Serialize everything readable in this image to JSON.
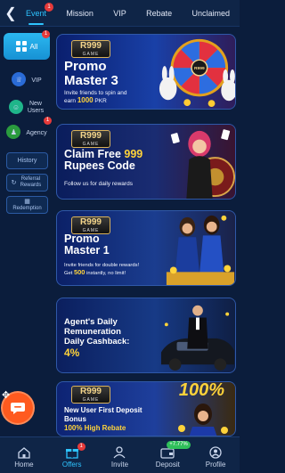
{
  "tabs": [
    {
      "label": "Event",
      "badge": "1",
      "active": true
    },
    {
      "label": "Mission",
      "badge": "",
      "active": false
    },
    {
      "label": "VIP",
      "badge": "",
      "active": false
    },
    {
      "label": "Rebate",
      "badge": "",
      "active": false
    },
    {
      "label": "Unclaimed",
      "badge": "",
      "active": false
    }
  ],
  "sidebar": {
    "items": [
      {
        "label": "All",
        "badge": "1",
        "icon": "grid-icon"
      },
      {
        "label": "VIP",
        "badge": "",
        "icon": "vip-crown-icon"
      },
      {
        "label": "New Users",
        "badge": "",
        "icon": "new-users-icon"
      },
      {
        "label": "Agency",
        "badge": "1",
        "icon": "agency-icon"
      }
    ],
    "buttons": [
      {
        "label": "History",
        "icon": ""
      },
      {
        "label": "Referral Rewards",
        "icon": "referral-icon"
      },
      {
        "label": "Redemption",
        "icon": "redemption-icon"
      }
    ]
  },
  "banners": [
    {
      "logo_main": "R999",
      "logo_sub": "GAME",
      "title_line1": "Promo",
      "title_line2": "Master 3",
      "sub_line1": "Invite friends to spin and",
      "sub_line2_prefix": "earn ",
      "sub_line2_amount": "1000",
      "sub_line2_suffix": " PKR",
      "wheel_center": "R999"
    },
    {
      "logo_main": "R999",
      "logo_sub": "GAME",
      "title_line1_prefix": "Claim Free ",
      "title_line1_amount": "999",
      "title_line2": "Rupees Code",
      "sub_line1": "Follow us for daily rewards"
    },
    {
      "logo_main": "R999",
      "logo_sub": "GAME",
      "title_line1": "Promo",
      "title_line2": "Master 1",
      "sub_line1": "Invite friends for double rewards!",
      "sub_line2_prefix": "Get ",
      "sub_line2_amount": "500",
      "sub_line2_suffix": " instantly, no limit!"
    },
    {
      "title_line1": "Agent's Daily",
      "title_line2": "Remuneration",
      "title_line3": "Daily Cashback:",
      "title_line4": "4%"
    },
    {
      "logo_main": "R999",
      "logo_sub": "GAME",
      "corner_big": "100%",
      "title_line1": "New User First Deposit",
      "title_line2": "Bonus",
      "title_line3": "100% High Rebate"
    }
  ],
  "bottom_nav": [
    {
      "label": "Home",
      "icon": "home-icon",
      "badge": "",
      "pill": "",
      "active": false
    },
    {
      "label": "Offers",
      "icon": "gift-icon",
      "badge": "1",
      "pill": "",
      "active": true
    },
    {
      "label": "Invite",
      "icon": "invite-icon",
      "badge": "",
      "pill": "",
      "active": false
    },
    {
      "label": "Deposit",
      "icon": "wallet-icon",
      "badge": "",
      "pill": "+7.77%",
      "active": false
    },
    {
      "label": "Profile",
      "icon": "profile-icon",
      "badge": "",
      "pill": "",
      "active": false
    }
  ],
  "colors": {
    "background": "#0b1d3c",
    "accent": "#2ec4ff",
    "badge": "#e53a3a",
    "gold": "#ffd33a",
    "chat": "#ff5a1f"
  }
}
